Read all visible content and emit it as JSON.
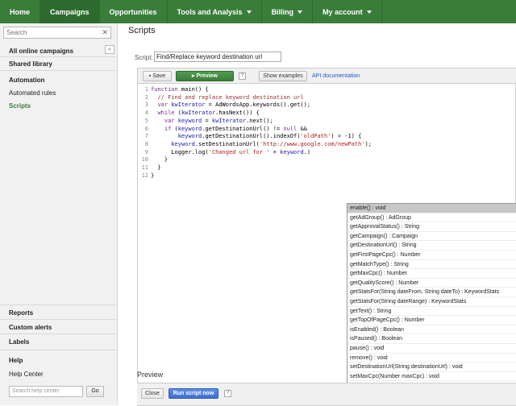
{
  "nav": {
    "tabs": [
      "Home",
      "Campaigns",
      "Opportunities",
      "Tools and Analysis",
      "Billing",
      "My account"
    ]
  },
  "sidebar": {
    "search_placeholder": "Search",
    "all_campaigns": "All online campaigns",
    "shared_library": "Shared library",
    "automation": "Automation",
    "automated_rules": "Automated rules",
    "scripts": "Scripts",
    "reports": "Reports",
    "custom_alerts": "Custom alerts",
    "labels": "Labels",
    "help": "Help",
    "help_center": "Help Center",
    "help_search_placeholder": "Search help center",
    "go": "Go"
  },
  "main": {
    "title": "Scripts",
    "script_label": "Script:",
    "script_name": "Find/Replace keyword destination url"
  },
  "toolbar": {
    "save": "Save",
    "preview": "Preview",
    "help": "?",
    "show_examples": "Show examples",
    "api_doc": "API documentation"
  },
  "code": {
    "line_numbers": [
      "1",
      "2",
      "3",
      "4",
      "5",
      "6",
      "7",
      "8",
      "9",
      "10",
      "11",
      "12"
    ]
  },
  "autocomplete": [
    "enable() : void",
    "getAdGroup() : AdGroup",
    "getApprovalStatus() : String",
    "getCampaign() : Campaign",
    "getDestinationUrl() : String",
    "getFirstPageCpc() : Number",
    "getMatchType() : String",
    "getMaxCpc() : Number",
    "getQualityScore() : Number",
    "getStatsFor(String dateFrom, String dateTo) : KeywordStats",
    "getStatsFor(String dateRange) : KeywordStats",
    "getText() : String",
    "getTopOfPageCpc() : Number",
    "isEnabled() : Boolean",
    "isPaused() : Boolean",
    "pause() : void",
    "remove() : void",
    "setDestinationUrl(String destinationUrl) : void",
    "setMaxCpc(Number maxCpc) : void"
  ],
  "preview": {
    "title": "Preview",
    "close": "Close",
    "run": "Run script now",
    "help": "?"
  },
  "colors": {
    "nav_green": "#3a7d3b",
    "active_tab": "#2d6a2e",
    "link_blue": "#2255cc",
    "run_blue": "#3c6fd1"
  }
}
